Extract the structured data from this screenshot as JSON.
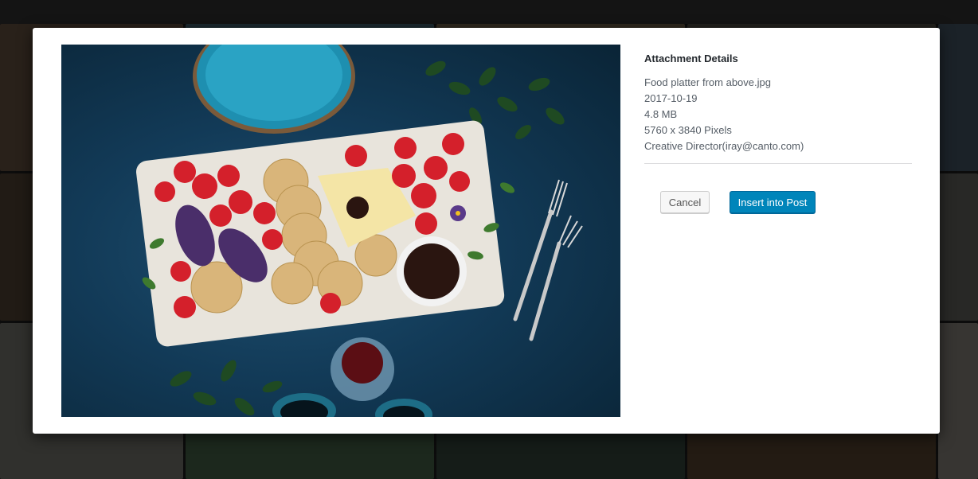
{
  "modal": {
    "heading": "Attachment Details",
    "filename": "Food platter from above.jpg",
    "date": "2017-10-19",
    "filesize": "4.8 MB",
    "dimensions": "5760 x 3840 Pixels",
    "author": "Creative Director(iray@canto.com)",
    "cancel_label": "Cancel",
    "insert_label": "Insert into Post"
  },
  "colors": {
    "primary_button": "#0085ba",
    "heading_text": "#23282d",
    "meta_text": "#555d66"
  },
  "preview_image": {
    "subject": "food-platter-photo"
  }
}
